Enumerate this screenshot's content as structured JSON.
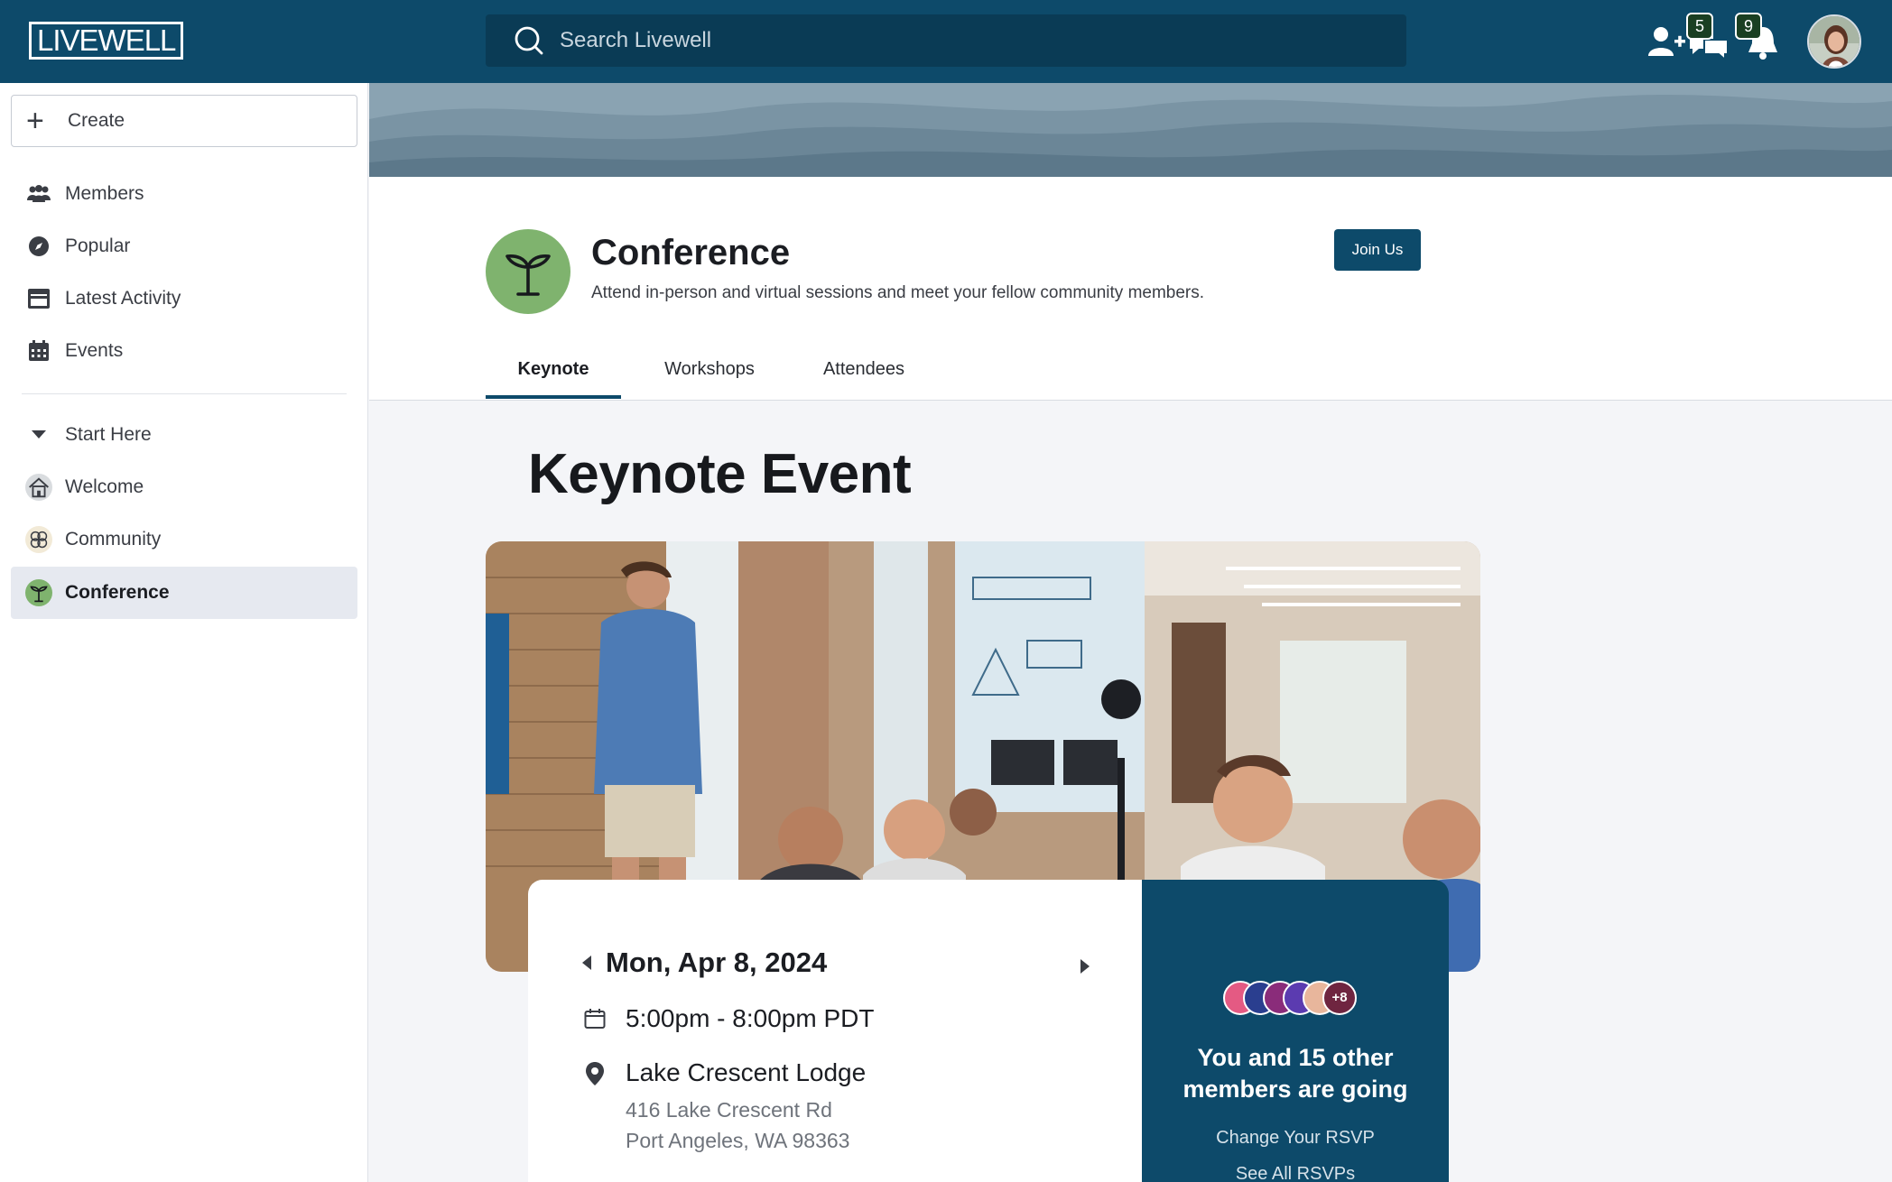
{
  "app": {
    "logo": "LIVEWELL"
  },
  "search": {
    "placeholder": "Search Livewell"
  },
  "header_icons": {
    "add_member": "add-person-icon",
    "chat_badge": "5",
    "notification_badge": "9"
  },
  "sidebar": {
    "create_label": "Create",
    "primary": [
      {
        "label": "Members",
        "icon": "members-icon"
      },
      {
        "label": "Popular",
        "icon": "compass-icon"
      },
      {
        "label": "Latest Activity",
        "icon": "activity-icon"
      },
      {
        "label": "Events",
        "icon": "calendar-icon"
      }
    ],
    "section_label": "Start Here",
    "groups": [
      {
        "label": "Welcome",
        "icon": "house-icon"
      },
      {
        "label": "Community",
        "icon": "community-icon"
      },
      {
        "label": "Conference",
        "icon": "sprout-icon",
        "active": true
      }
    ]
  },
  "group": {
    "title": "Conference",
    "description": "Attend in-person and virtual sessions and meet your fellow community members.",
    "join_label": "Join Us",
    "tabs": [
      "Keynote",
      "Workshops",
      "Attendees"
    ],
    "active_tab": "Keynote"
  },
  "event": {
    "title": "Keynote Event",
    "date": "Mon, Apr 8, 2024",
    "time": "5:00pm - 8:00pm PDT",
    "venue": "Lake Crescent Lodge",
    "address_line1": "416 Lake Crescent Rd",
    "address_line2": "Port Angeles, WA 98363"
  },
  "rsvp": {
    "extra_count": "+8",
    "going_text": "You and 15 other members are going",
    "change_label": "Change Your RSVP",
    "see_all_label": "See All RSVPs"
  },
  "colors": {
    "brand": "#0d4a6a",
    "accent_green": "#7fb36e"
  }
}
